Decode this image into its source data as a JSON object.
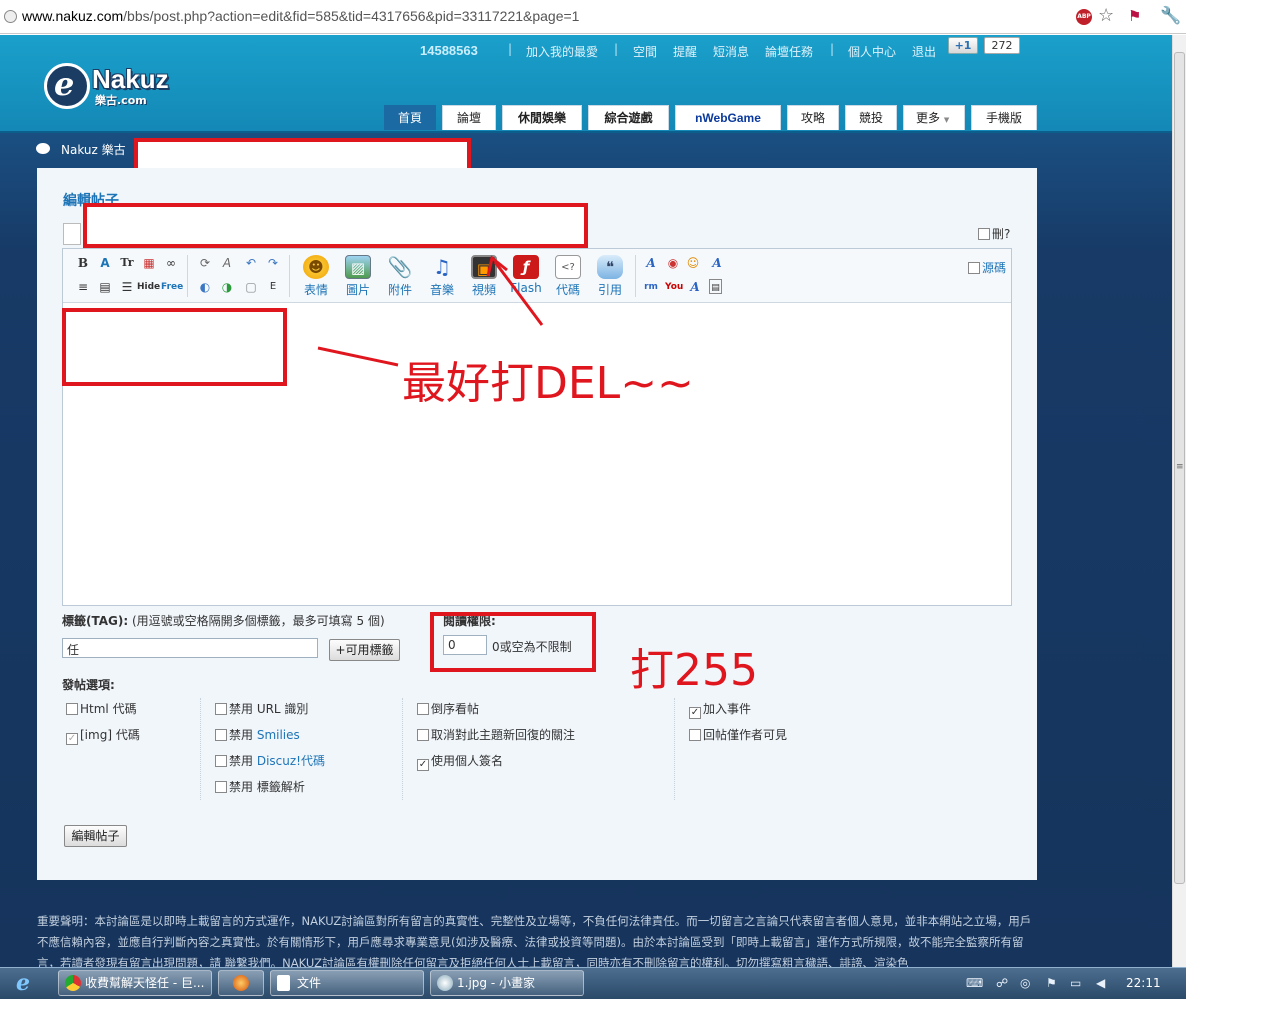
{
  "browser": {
    "url_domain": "www.nakuz.com",
    "url_rest": "/bbs/post.php?action=edit&fid=585&tid=4317656&pid=33117221&page=1",
    "abp": "ABP"
  },
  "header": {
    "uid": "14588563",
    "links": [
      "加入我的最愛",
      "空間",
      "提醒",
      "短消息",
      "論壇任務",
      "個人中心",
      "退出"
    ],
    "plus_one": "+1",
    "plus_one_count": "272",
    "logo_name": "Nakuz",
    "logo_sub": "樂古.com",
    "tabs": [
      "首頁",
      "論壇",
      "休閒娛樂",
      "綜合遊戲",
      "nWebGame",
      "攻略",
      "競投",
      "更多",
      "手機版"
    ],
    "more_arrow": "▼"
  },
  "breadcrumb": "Nakuz 樂古",
  "editor": {
    "title": "編輯帖子",
    "delete_label": "刪?",
    "source_label": "源碼",
    "buttons": [
      "表情",
      "圖片",
      "附件",
      "音樂",
      "視頻",
      "Flash",
      "代碼",
      "引用"
    ],
    "small_icons_row1": [
      "B",
      "A",
      "Tr",
      "▦",
      "∞",
      "⟳",
      "A",
      "↶",
      "↷"
    ],
    "small_icons_row2": [
      "≡",
      "▤",
      "☰",
      "Hide",
      "Free",
      "◐",
      "◑",
      "▢",
      "E"
    ]
  },
  "tags": {
    "label": "標籤(TAG):",
    "hint": "(用逗號或空格隔開多個標籤，最多可填寫 5 個)",
    "value": "任",
    "button": "+可用標籤"
  },
  "read_perm": {
    "label": "閱讀權限:",
    "value": "0",
    "hint": "0或空為不限制"
  },
  "options": {
    "title": "發帖選項:",
    "col1": [
      {
        "label": "Html 代碼",
        "checked": false,
        "blue": ""
      },
      {
        "label": "[img] 代碼",
        "checked": true,
        "blue": ""
      }
    ],
    "col2": [
      {
        "label": "禁用 URL 識別",
        "checked": false,
        "blue": ""
      },
      {
        "label": "禁用 ",
        "checked": false,
        "blue": "Smilies"
      },
      {
        "label": "禁用 ",
        "checked": false,
        "blue": "Discuz!代碼"
      },
      {
        "label": "禁用 標籤解析",
        "checked": false,
        "blue": ""
      }
    ],
    "col3": [
      {
        "label": "倒序看帖",
        "checked": false,
        "blue": ""
      },
      {
        "label": "取消對此主題新回復的關注",
        "checked": false,
        "blue": ""
      },
      {
        "label": "使用個人簽名",
        "checked": true,
        "blue": ""
      }
    ],
    "col4": [
      {
        "label": "加入事件",
        "checked": true,
        "blue": ""
      },
      {
        "label": "回帖僅作者可見",
        "checked": false,
        "blue": ""
      }
    ]
  },
  "submit": "編輯帖子",
  "annotations": {
    "del": "最好打DEL~~",
    "perm": "打255"
  },
  "footer": "重要聲明：本討論區是以即時上載留言的方式運作，NAKUZ討論區對所有留言的真實性、完整性及立場等，不負任何法律責任。而一切留言之言論只代表留言者個人意見，並非本網站之立場，用戶不應信賴內容，並應自行判斷內容之真實性。於有關情形下，用戶應尋求專業意見(如涉及醫療、法律或投資等問題)。由於本討論區受到「即時上載留言」運作方式所規限，故不能完全監察所有留言，若讀者發現有留言出現問題，請 聯繫我們。NAKUZ討論區有權刪除任何留言及拒絕任何人士上載留言，同時亦有不刪除留言的權利。切勿撰寫粗言穢語、誹謗、渲染色",
  "taskbar": {
    "tasks": [
      "收費幫解天怪任 - 巨...",
      "",
      "文件",
      "1.jpg - 小畫家"
    ],
    "clock": "22:11"
  }
}
